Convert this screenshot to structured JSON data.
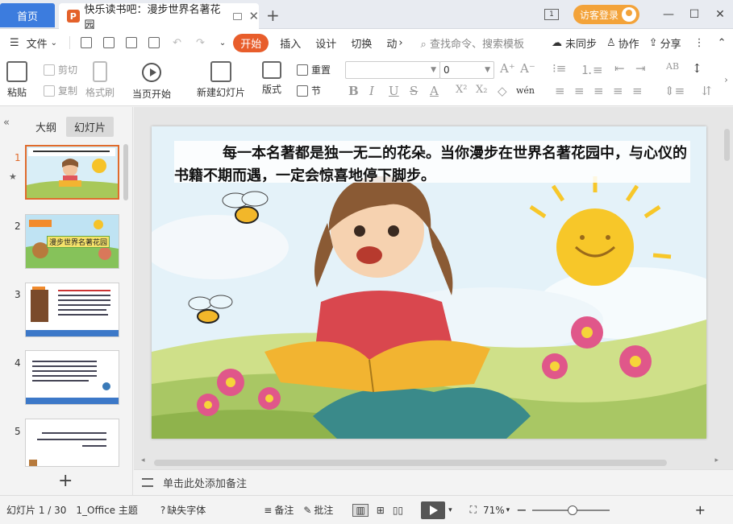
{
  "titlebar": {
    "home_tab": "首页",
    "doc_tab_badge": "P",
    "doc_tab_title": "快乐读书吧：漫步世界名著花园",
    "new_tab_symbol": "+",
    "workspace_label": "1",
    "login_label": "访客登录",
    "minimize": "—",
    "maximize": "☐",
    "close": "✕"
  },
  "menu": {
    "file": "文件",
    "active_tab": "开始",
    "tabs": [
      "插入",
      "设计",
      "切换",
      "动"
    ],
    "search_placeholder": "查找命令、搜索模板",
    "sync": "未同步",
    "collab": "协作",
    "share": "分享"
  },
  "ribbon": {
    "paste": "粘贴",
    "cut": "剪切",
    "copy": "复制",
    "format_painter": "格式刷",
    "play_from_current": "当页开始",
    "new_slide": "新建幻灯片",
    "layout": "版式",
    "reset": "重置",
    "section": "节",
    "font_size_value": "0",
    "bold": "B",
    "italic": "I",
    "underline": "U",
    "strike": "S",
    "font_color": "A",
    "superscript": "X²",
    "subscript": "X₂",
    "phonetic": "wén"
  },
  "left_panel": {
    "outline_tab": "大纲",
    "slides_tab": "幻灯片",
    "slide_numbers": [
      "1",
      "2",
      "3",
      "4",
      "5"
    ],
    "thumb2_caption": "漫步世界名著花园",
    "add_slide": "+"
  },
  "slide": {
    "text": "每一本名著都是独一无二的花朵。当你漫步在世界名著花园中，与心仪的书籍不期而遇，一定会惊喜地停下脚步。"
  },
  "notes": {
    "placeholder": "单击此处添加备注"
  },
  "status": {
    "slide_position": "幻灯片 1 / 30",
    "theme": "1_Office 主题",
    "missing_font": "缺失字体",
    "notes_btn": "备注",
    "comment_btn": "批注",
    "zoom": "71%",
    "zoom_out": "−",
    "zoom_in": "+"
  },
  "colors": {
    "accent_orange": "#e85d2b",
    "home_blue": "#3c7cde",
    "login_orange": "#f3a33a"
  }
}
